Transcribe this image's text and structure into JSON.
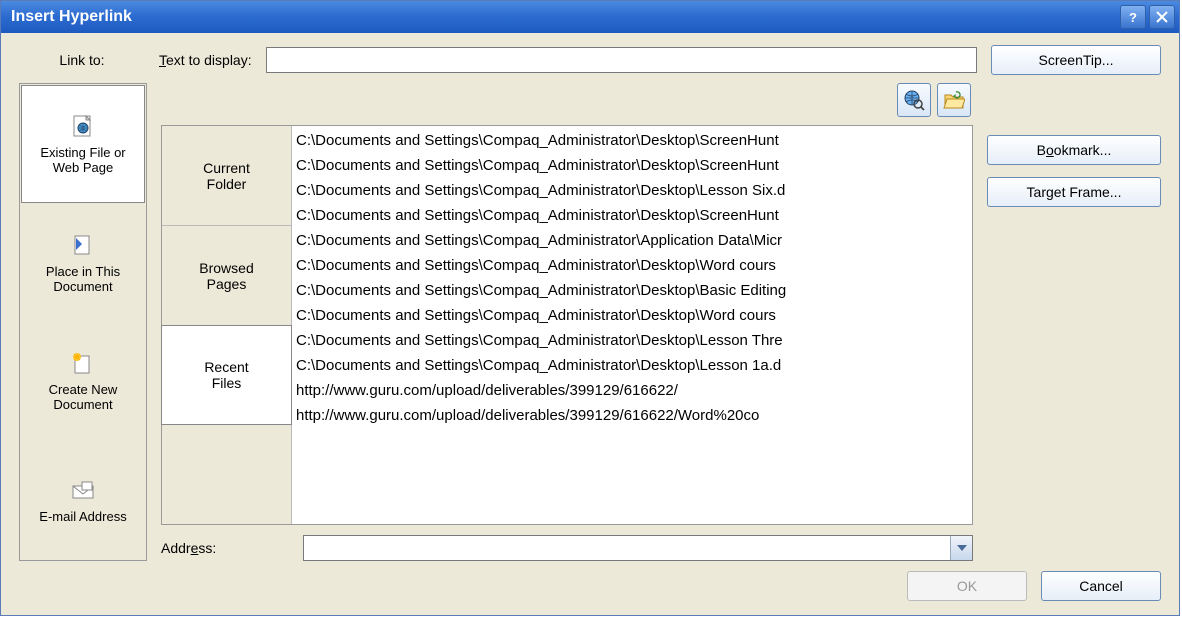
{
  "title": "Insert Hyperlink",
  "labels": {
    "link_to": "Link to:",
    "text_to_display": "Text to display:",
    "address": "Address:"
  },
  "buttons": {
    "screentip": "ScreenTip...",
    "bookmark": "Bookmark...",
    "target_frame": "Target Frame...",
    "ok": "OK",
    "cancel": "Cancel"
  },
  "left_nav": [
    {
      "label": "Existing File or\nWeb Page",
      "selected": true
    },
    {
      "label": "Place in This\nDocument",
      "selected": false
    },
    {
      "label": "Create New\nDocument",
      "selected": false
    },
    {
      "label": "E-mail Address",
      "selected": false
    }
  ],
  "mode_tabs": [
    {
      "label": "Current\nFolder",
      "selected": false
    },
    {
      "label": "Browsed\nPages",
      "selected": false
    },
    {
      "label": "Recent\nFiles",
      "selected": true
    }
  ],
  "text_to_display_value": "",
  "address_value": "",
  "file_list": [
    "C:\\Documents and Settings\\Compaq_Administrator\\Desktop\\ScreenHunt",
    "C:\\Documents and Settings\\Compaq_Administrator\\Desktop\\ScreenHunt",
    "C:\\Documents and Settings\\Compaq_Administrator\\Desktop\\Lesson Six.d",
    "C:\\Documents and Settings\\Compaq_Administrator\\Desktop\\ScreenHunt",
    "C:\\Documents and Settings\\Compaq_Administrator\\Application Data\\Micr",
    "C:\\Documents and Settings\\Compaq_Administrator\\Desktop\\Word cours",
    "C:\\Documents and Settings\\Compaq_Administrator\\Desktop\\Basic Editing",
    "C:\\Documents and Settings\\Compaq_Administrator\\Desktop\\Word cours",
    "C:\\Documents and Settings\\Compaq_Administrator\\Desktop\\Lesson Thre",
    "C:\\Documents and Settings\\Compaq_Administrator\\Desktop\\Lesson 1a.d",
    "http://www.guru.com/upload/deliverables/399129/616622/",
    "http://www.guru.com/upload/deliverables/399129/616622/Word%20co"
  ]
}
